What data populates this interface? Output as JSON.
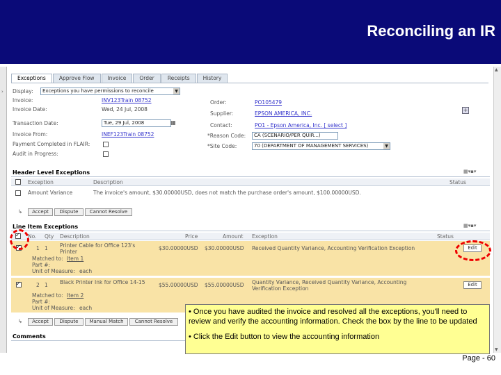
{
  "slide": {
    "title": "Reconciling an IR",
    "page": "Page - 60",
    "callout": {
      "bullet1": "• Once you have audited the invoice and resolved all the exceptions, you'll need to review and verify the accounting information. Check the box by the line to be updated",
      "bullet2": "• Click the Edit button to view the accounting information"
    },
    "colors": {
      "banner": "#0a0a78",
      "callout": "#ffff93",
      "highlight_row": "#f9e3a6",
      "annotation": "#e00000"
    }
  },
  "tabs": [
    "Exceptions",
    "Approve Flow",
    "Invoice",
    "Order",
    "Receipts",
    "History"
  ],
  "form": {
    "display_label": "Display:",
    "display_value": "Exceptions you have permissions to reconcile",
    "invoice_label": "Invoice:",
    "invoice_value": "INV123Train 08752",
    "invoice_date_label": "Invoice Date:",
    "invoice_date_value": "Wed, 24 Jul, 2008",
    "transaction_date_label": "Transaction Date:",
    "transaction_date_value": "Tue, 29 Jul, 2008",
    "invoice_from_label": "Invoice From:",
    "invoice_from_value": "INEF123Train 08752",
    "payment_completed_label": "Payment Completed in FLAIR:",
    "audit_label": "Audit in Progress:",
    "order_label": "Order:",
    "order_value": "PO105479",
    "supplier_label": "Supplier:",
    "supplier_value": "EPSON AMERICA, INC.",
    "contact_label": "Contact:",
    "contact_value": "PO1 - Epson America, Inc. [ select ]",
    "reason_code_label": "*Reason Code:",
    "reason_code_value": "CA (SCENARIO/PER QUIR...)",
    "site_code_label": "*Site Code:",
    "site_code_value": "70 (DEPARTMENT OF MANAGEMENT SERVICES)"
  },
  "header_exceptions": {
    "title": "Header Level Exceptions",
    "columns": [
      "Exception",
      "Description",
      "Status"
    ],
    "row": {
      "exception": "Amount Variance",
      "description": "The invoice's amount, $30.00000USD, does not match the purchase order's amount, $100.00000USD."
    },
    "buttons": [
      "Accept",
      "Dispute",
      "Cannot Resolve"
    ]
  },
  "line_exceptions": {
    "title": "Line Item Exceptions",
    "columns": [
      "No.",
      "Qty",
      "Description",
      "Price",
      "Amount",
      "Exception",
      "Status"
    ],
    "rows": [
      {
        "no": "1",
        "qty": "1",
        "description": "Printer Cable for Office 123's Printer",
        "price": "$30.00000USD",
        "amount": "$30.00000USD",
        "exception": "Received Quantity Variance, Accounting Verification Exception",
        "matched_label": "Matched to:",
        "matched_value": "Item 1",
        "part_label": "Part #:",
        "uom_label": "Unit of Measure:",
        "uom_value": "each",
        "edit": "Edit"
      },
      {
        "no": "2",
        "qty": "1",
        "description": "Black Printer Ink for Office 14-15",
        "price": "$55.00000USD",
        "amount": "$55.00000USD",
        "exception": "Quantity Variance, Received Quantity Variance, Accounting Verification Exception",
        "matched_label": "Matched to:",
        "matched_value": "Item 2",
        "part_label": "Part #:",
        "uom_label": "Unit of Measure:",
        "uom_value": "each",
        "edit": "Edit"
      }
    ],
    "buttons": [
      "Accept",
      "Dispute",
      "Manual Match",
      "Cannot Resolve"
    ]
  },
  "comments": {
    "title": "Comments"
  }
}
